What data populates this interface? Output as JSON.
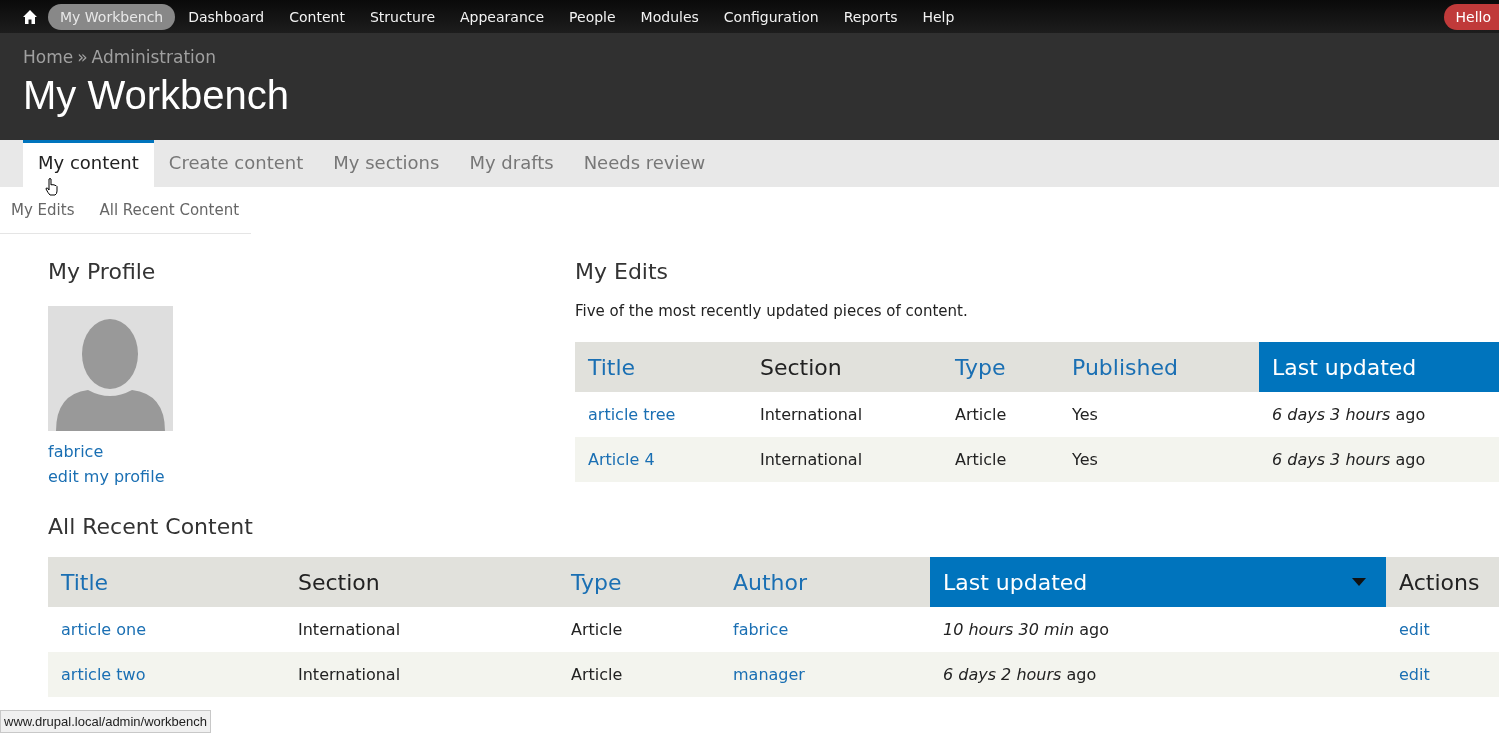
{
  "toolbar": {
    "items": [
      {
        "label": "My Workbench",
        "selected": true
      },
      {
        "label": "Dashboard",
        "selected": false
      },
      {
        "label": "Content",
        "selected": false
      },
      {
        "label": "Structure",
        "selected": false
      },
      {
        "label": "Appearance",
        "selected": false
      },
      {
        "label": "People",
        "selected": false
      },
      {
        "label": "Modules",
        "selected": false
      },
      {
        "label": "Configuration",
        "selected": false
      },
      {
        "label": "Reports",
        "selected": false
      },
      {
        "label": "Help",
        "selected": false
      }
    ],
    "user_button": "Hello"
  },
  "breadcrumb": [
    "Home",
    "Administration"
  ],
  "breadcrumb_separator": "»",
  "title": "My Workbench",
  "tabs": [
    {
      "label": "My content",
      "selected": true
    },
    {
      "label": "Create content",
      "selected": false
    },
    {
      "label": "My sections",
      "selected": false
    },
    {
      "label": "My drafts",
      "selected": false
    },
    {
      "label": "Needs review",
      "selected": false
    }
  ],
  "subtabs": [
    "My Edits",
    "All Recent Content"
  ],
  "profile": {
    "heading": "My Profile",
    "username": "fabrice",
    "edit_link": "edit my profile"
  },
  "my_edits": {
    "heading": "My Edits",
    "description": "Five of the most recently updated pieces of content.",
    "columns": [
      {
        "label": "Title",
        "sortable": true,
        "active": false,
        "kind": "link"
      },
      {
        "label": "Section",
        "sortable": false,
        "active": false,
        "kind": "text"
      },
      {
        "label": "Type",
        "sortable": true,
        "active": false,
        "kind": "text"
      },
      {
        "label": "Published",
        "sortable": true,
        "active": false,
        "kind": "text"
      },
      {
        "label": "Last updated",
        "sortable": true,
        "active": true,
        "kind": "rich"
      }
    ],
    "rows": [
      [
        "article tree",
        "International",
        "Article",
        "Yes",
        "*6 days 3 hours* ago"
      ],
      [
        "Article 4",
        "International",
        "Article",
        "Yes",
        "*6 days 3 hours* ago"
      ]
    ]
  },
  "recent": {
    "heading": "All Recent Content",
    "columns": [
      {
        "label": "Title",
        "sortable": true,
        "active": false,
        "kind": "link"
      },
      {
        "label": "Section",
        "sortable": false,
        "active": false,
        "kind": "text"
      },
      {
        "label": "Type",
        "sortable": true,
        "active": false,
        "kind": "text"
      },
      {
        "label": "Author",
        "sortable": true,
        "active": false,
        "kind": "link"
      },
      {
        "label": "Last updated",
        "sortable": true,
        "active": true,
        "kind": "rich",
        "sort_caret": true
      },
      {
        "label": "Actions",
        "sortable": false,
        "active": false,
        "kind": "link"
      }
    ],
    "rows": [
      [
        "article one",
        "International",
        "Article",
        "fabrice",
        "*10 hours 30 min* ago",
        "edit"
      ],
      [
        "article two",
        "International",
        "Article",
        "manager",
        "*6 days 2 hours* ago",
        "edit"
      ]
    ]
  },
  "status_url": "www.drupal.local/admin/workbench"
}
